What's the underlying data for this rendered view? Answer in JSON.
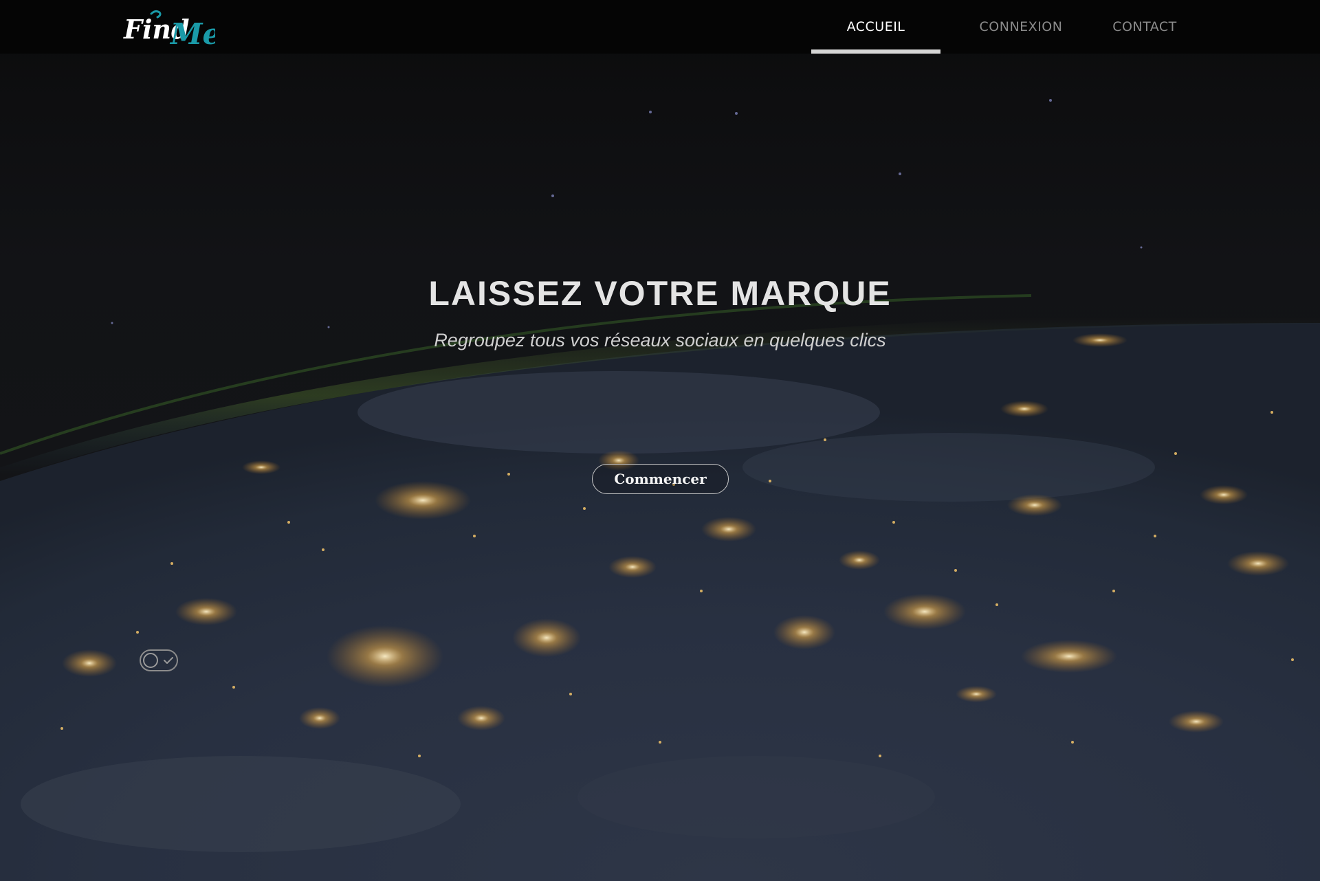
{
  "brand": {
    "logo_word_1": "Find",
    "logo_word_2": "Me",
    "accent_color": "#1a9aa8"
  },
  "nav": {
    "items": [
      {
        "label": "ACCUEIL",
        "active": true
      },
      {
        "label": "CONNEXION",
        "active": false
      },
      {
        "label": "CONTACT",
        "active": false
      }
    ]
  },
  "hero": {
    "title": "LAISSEZ VOTRE MARQUE",
    "subtitle": "Regroupez tous vos réseaux sociaux en quelques clics",
    "cta_label": "Commencer",
    "background": "night earth from orbit with city lights"
  },
  "toggle": {
    "icon": "toggle-check-icon",
    "state": "off"
  }
}
